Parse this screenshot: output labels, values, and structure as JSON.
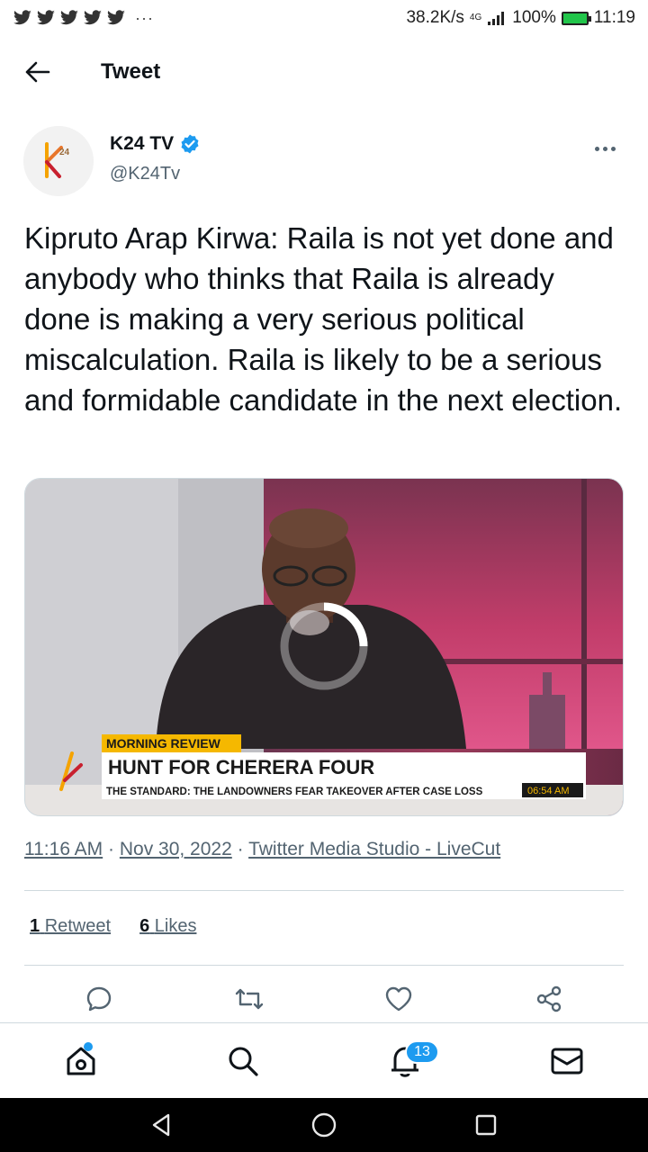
{
  "status_bar": {
    "speed": "38.2K/s",
    "network_type": "4G",
    "battery": "100%",
    "time": "11:19",
    "notification_icons": [
      "twitter-icon",
      "twitter-icon",
      "twitter-icon",
      "twitter-icon",
      "twitter-icon"
    ],
    "more": "···"
  },
  "header": {
    "title": "Tweet"
  },
  "author": {
    "name": "K24 TV",
    "handle": "@K24Tv",
    "verified": true
  },
  "tweet": {
    "text": "Kipruto Arap Kirwa: Raila is not yet done and anybody who thinks that Raila is already done is making a very serious political miscalculation. Raila is likely to be a serious and formidable candidate in the next election."
  },
  "media": {
    "kicker": "MORNING REVIEW",
    "headline": "HUNT FOR CHERERA FOUR",
    "ticker": "THE STANDARD: THE LANDOWNERS FEAR TAKEOVER AFTER CASE LOSS",
    "clock": "06:54 AM",
    "logo_text": "24"
  },
  "meta": {
    "time": "11:16 AM",
    "date": "Nov 30, 2022",
    "source": "Twitter Media Studio - LiveCut",
    "separator": " · "
  },
  "stats": {
    "retweets_count": "1",
    "retweets_label": "Retweet",
    "likes_count": "6",
    "likes_label": "Likes"
  },
  "bottom_nav": {
    "notifications_badge": "13"
  },
  "colors": {
    "accent": "#1d9bf0",
    "text": "#0f1419",
    "muted": "#536471",
    "lower_third_yellow": "#f5b800"
  }
}
